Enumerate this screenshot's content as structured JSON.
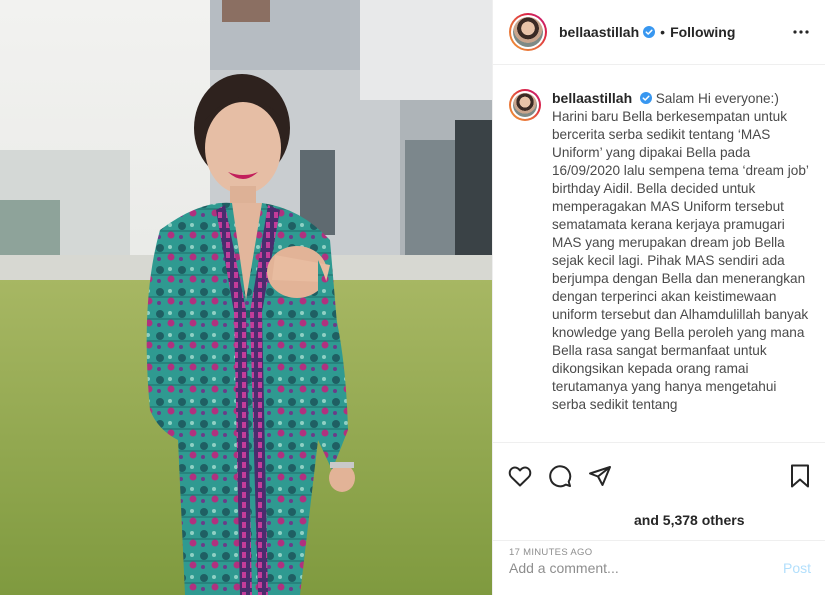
{
  "post": {
    "username": "bellaastillah",
    "follow_separator": "•",
    "follow_status": "Following",
    "photo_alt": "Woman in batik uniform smiling outdoors"
  },
  "caption": {
    "username": "bellaastillah",
    "text": "Salam Hi everyone:) Harini baru Bella berkesempatan untuk bercerita serba sedikit tentang ‘MAS Uniform’ yang dipakai Bella pada 16/09/2020 lalu sempena tema ‘dream job’ birthday Aidil. Bella decided untuk memperagakan MAS Uniform tersebut sematamata kerana kerjaya pramugari MAS yang merupakan dream job Bella sejak kecil lagi. Pihak MAS sendiri ada berjumpa dengan Bella dan menerangkan dengan terperinci akan keistimewaan uniform tersebut dan Alhamdulillah banyak knowledge yang Bella peroleh yang mana Bella rasa sangat bermanfaat untuk dikongsikan kepada orang ramai terutamanya yang hanya mengetahui serba sedikit tentang"
  },
  "engagement": {
    "likes_text": "and 5,378 others",
    "timestamp": "17 MINUTES AGO"
  },
  "comment": {
    "placeholder": "Add a comment...",
    "post_label": "Post"
  },
  "icons": {
    "like": "heart-icon",
    "comment": "comment-icon",
    "share": "share-icon",
    "save": "bookmark-icon",
    "more": "more-options-icon",
    "verified": "verified-badge-icon"
  },
  "colors": {
    "verified": "#3897f0",
    "post_button_disabled": "#b2dffc",
    "secondary_text": "#8e8e8e"
  }
}
